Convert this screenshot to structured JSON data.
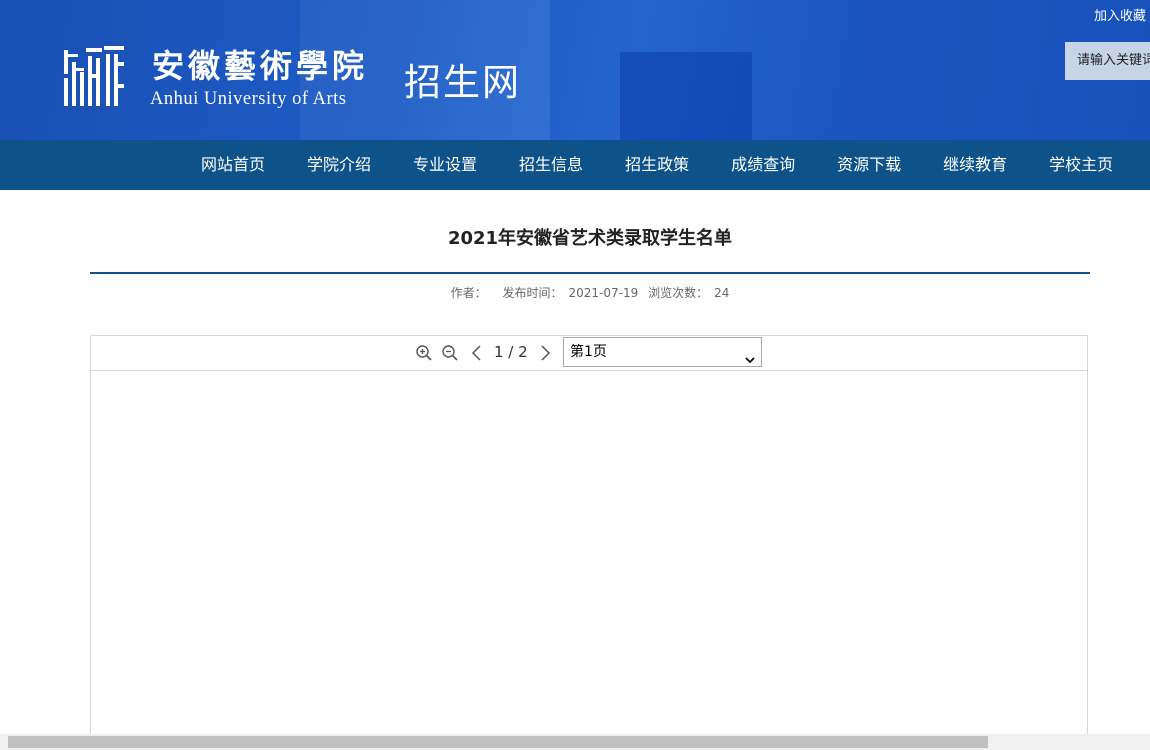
{
  "header": {
    "logo_cn": "安徽藝術學院",
    "logo_en": "Anhui University of Arts",
    "site_name": "招生网",
    "favorite_link": "加入收藏",
    "search_placeholder": "请输入关键词"
  },
  "nav": {
    "items": [
      "网站首页",
      "学院介绍",
      "专业设置",
      "招生信息",
      "招生政策",
      "成绩查询",
      "资源下载",
      "继续教育",
      "学校主页"
    ]
  },
  "article": {
    "title": "2021年安徽省艺术类录取学生名单",
    "author_label": "作者：",
    "author": "",
    "publish_label": "发布时间：",
    "publish_date": "2021-07-19",
    "views_label": "浏览次数：",
    "views": "24"
  },
  "viewer": {
    "page_indicator": "1 / 2",
    "page_select_value": "第1页",
    "icons": [
      "zoom-in-icon",
      "zoom-out-icon",
      "chevron-left-icon",
      "chevron-right-icon"
    ]
  },
  "colors": {
    "banner": "#1d5cc6",
    "nav": "#0d5288",
    "rule": "#0d5288"
  }
}
